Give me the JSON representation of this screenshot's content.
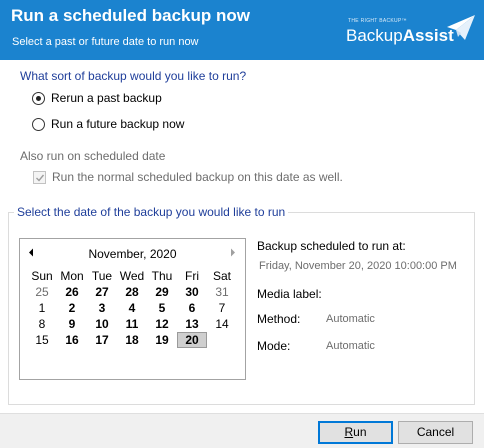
{
  "header": {
    "title": "Run a scheduled backup now",
    "subtitle": "Select a past or future date to run now",
    "logo": {
      "tagline": "THE RIGHT BACKUP™",
      "name_part1": "Backup",
      "name_part2": "Assist"
    }
  },
  "options": {
    "question": "What sort of backup would you like to run?",
    "radios": [
      {
        "label": "Rerun a past backup",
        "checked": true
      },
      {
        "label": "Run a future backup now",
        "checked": false
      }
    ],
    "also_label": "Also run on scheduled date",
    "also_checkbox": {
      "label": "Run the normal scheduled backup on this date as well.",
      "checked": true,
      "enabled": false
    }
  },
  "date_group": {
    "title": "Select the date of the backup you would like to run"
  },
  "calendar": {
    "month_label": "November, 2020",
    "weekdays": [
      "Sun",
      "Mon",
      "Tue",
      "Wed",
      "Thu",
      "Fri",
      "Sat"
    ],
    "weeks": [
      [
        {
          "d": "25",
          "o": true
        },
        {
          "d": "26",
          "b": true
        },
        {
          "d": "27",
          "b": true
        },
        {
          "d": "28",
          "b": true
        },
        {
          "d": "29",
          "b": true
        },
        {
          "d": "30",
          "b": true
        },
        {
          "d": "31",
          "o": true
        }
      ],
      [
        {
          "d": "1"
        },
        {
          "d": "2",
          "b": true
        },
        {
          "d": "3",
          "b": true
        },
        {
          "d": "4",
          "b": true
        },
        {
          "d": "5",
          "b": true
        },
        {
          "d": "6",
          "b": true
        },
        {
          "d": "7"
        }
      ],
      [
        {
          "d": "8"
        },
        {
          "d": "9",
          "b": true
        },
        {
          "d": "10",
          "b": true
        },
        {
          "d": "11",
          "b": true
        },
        {
          "d": "12",
          "b": true
        },
        {
          "d": "13",
          "b": true
        },
        {
          "d": "14"
        }
      ],
      [
        {
          "d": "15"
        },
        {
          "d": "16",
          "b": true
        },
        {
          "d": "17",
          "b": true
        },
        {
          "d": "18",
          "b": true
        },
        {
          "d": "19",
          "b": true
        },
        {
          "d": "20",
          "b": true,
          "s": true
        },
        {
          "d": ""
        }
      ]
    ]
  },
  "details": {
    "scheduled_label": "Backup scheduled to run at:",
    "scheduled_value": "Friday, November 20, 2020 10:00:00 PM",
    "media_label": "Media label:",
    "method_label": "Method:",
    "method_value": "Automatic",
    "mode_label": "Mode:",
    "mode_value": "Automatic"
  },
  "buttons": {
    "run_first": "R",
    "run_rest": "un",
    "cancel": "Cancel"
  },
  "colors": {
    "header_bg": "#1b83cf",
    "accent_text": "#1f3e9a",
    "selected_day": "#cfcfcf"
  }
}
